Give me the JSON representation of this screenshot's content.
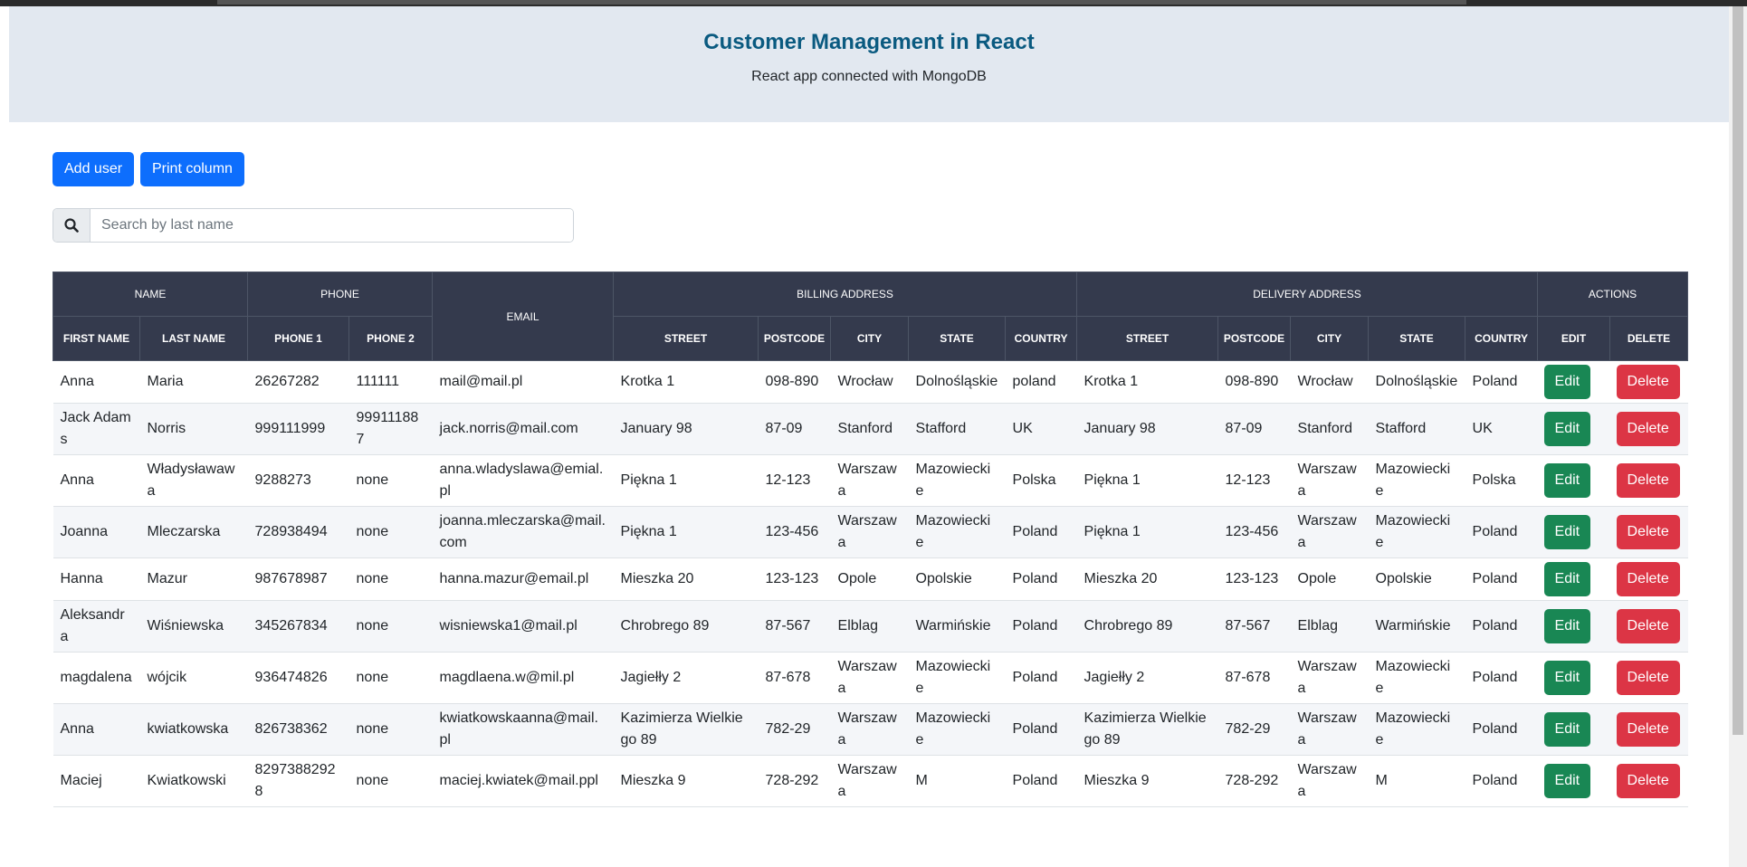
{
  "header": {
    "title": "Customer Management in React",
    "subtitle": "React app connected with MongoDB"
  },
  "toolbar": {
    "add_user_label": "Add user",
    "print_column_label": "Print column"
  },
  "search": {
    "icon": "search-icon",
    "placeholder": "Search by last name",
    "value": ""
  },
  "table": {
    "groups": {
      "name": "NAME",
      "phone": "PHONE",
      "email": "EMAIL",
      "billing": "BILLING ADDRESS",
      "delivery": "DELIVERY ADDRESS",
      "actions": "ACTIONS"
    },
    "columns": {
      "first_name": "FIRST NAME",
      "last_name": "LAST NAME",
      "phone1": "PHONE 1",
      "phone2": "PHONE 2",
      "b_street": "STREET",
      "b_postcode": "POSTCODE",
      "b_city": "CITY",
      "b_state": "STATE",
      "b_country": "COUNTRY",
      "d_street": "STREET",
      "d_postcode": "POSTCODE",
      "d_city": "CITY",
      "d_state": "STATE",
      "d_country": "COUNTRY",
      "edit": "EDIT",
      "delete": "DELETE"
    },
    "edit_label": "Edit",
    "delete_label": "Delete",
    "rows": [
      {
        "first": "Anna",
        "last": "Maria",
        "phone1": "26267282",
        "phone2": "111111",
        "email": "mail@mail.pl",
        "b_street": "Krotka 1",
        "b_postcode": "098-890",
        "b_city": "Wrocław",
        "b_state": "Dolnośląskie",
        "b_country": "poland",
        "d_street": "Krotka 1",
        "d_postcode": "098-890",
        "d_city": "Wrocław",
        "d_state": "Dolnośląskie",
        "d_country": "Poland"
      },
      {
        "first": "Jack Adams",
        "last": "Norris",
        "phone1": "999111999",
        "phone2": "999111887",
        "email": "jack.norris@mail.com",
        "b_street": "January 98",
        "b_postcode": "87-09",
        "b_city": "Stanford",
        "b_state": "Stafford",
        "b_country": "UK",
        "d_street": "January 98",
        "d_postcode": "87-09",
        "d_city": "Stanford",
        "d_state": "Stafford",
        "d_country": "UK"
      },
      {
        "first": "Anna",
        "last": "Władysławawa",
        "phone1": "9288273",
        "phone2": "none",
        "email": "anna.wladyslawa@emial.pl",
        "b_street": "Piękna 1",
        "b_postcode": "12-123",
        "b_city": "Warszawa",
        "b_state": "Mazowieckie",
        "b_country": "Polska",
        "d_street": "Piękna 1",
        "d_postcode": "12-123",
        "d_city": "Warszawa",
        "d_state": "Mazowieckie",
        "d_country": "Polska"
      },
      {
        "first": "Joanna",
        "last": "Mleczarska",
        "phone1": "728938494",
        "phone2": "none",
        "email": "joanna.mleczarska@mail.com",
        "b_street": "Piękna 1",
        "b_postcode": "123-456",
        "b_city": "Warszawa",
        "b_state": "Mazowieckie",
        "b_country": "Poland",
        "d_street": "Piękna 1",
        "d_postcode": "123-456",
        "d_city": "Warszawa",
        "d_state": "Mazowieckie",
        "d_country": "Poland"
      },
      {
        "first": "Hanna",
        "last": "Mazur",
        "phone1": "987678987",
        "phone2": "none",
        "email": "hanna.mazur@email.pl",
        "b_street": "Mieszka 20",
        "b_postcode": "123-123",
        "b_city": "Opole",
        "b_state": "Opolskie",
        "b_country": "Poland",
        "d_street": "Mieszka 20",
        "d_postcode": "123-123",
        "d_city": "Opole",
        "d_state": "Opolskie",
        "d_country": "Poland"
      },
      {
        "first": "Aleksandra",
        "last": "Wiśniewska",
        "phone1": "345267834",
        "phone2": "none",
        "email": "wisniewska1@mail.pl",
        "b_street": "Chrobrego 89",
        "b_postcode": "87-567",
        "b_city": "Elblag",
        "b_state": "Warmińskie",
        "b_country": "Poland",
        "d_street": "Chrobrego 89",
        "d_postcode": "87-567",
        "d_city": "Elblag",
        "d_state": "Warmińskie",
        "d_country": "Poland"
      },
      {
        "first": "magdalena",
        "last": "wójcik",
        "phone1": "936474826",
        "phone2": "none",
        "email": "magdlaena.w@mil.pl",
        "b_street": "Jagiełły 2",
        "b_postcode": "87-678",
        "b_city": "Warszawa",
        "b_state": "Mazowieckie",
        "b_country": "Poland",
        "d_street": "Jagiełły 2",
        "d_postcode": "87-678",
        "d_city": "Warszawa",
        "d_state": "Mazowieckie",
        "d_country": "Poland"
      },
      {
        "first": "Anna",
        "last": "kwiatkowska",
        "phone1": "826738362",
        "phone2": "none",
        "email": "kwiatkowskaanna@mail.pl",
        "b_street": "Kazimierza Wielkiego 89",
        "b_postcode": "782-29",
        "b_city": "Warszawa",
        "b_state": "Mazowieckie",
        "b_country": "Poland",
        "d_street": "Kazimierza Wielkiego 89",
        "d_postcode": "782-29",
        "d_city": "Warszawa",
        "d_state": "Mazowieckie",
        "d_country": "Poland"
      },
      {
        "first": "Maciej",
        "last": "Kwiatkowski",
        "phone1": "82973882928",
        "phone2": "none",
        "email": "maciej.kwiatek@mail.ppl",
        "b_street": "Mieszka 9",
        "b_postcode": "728-292",
        "b_city": "Warszawa",
        "b_state": "M",
        "b_country": "Poland",
        "d_street": "Mieszka 9",
        "d_postcode": "728-292",
        "d_city": "Warszawa",
        "d_state": "M",
        "d_country": "Poland"
      }
    ]
  }
}
